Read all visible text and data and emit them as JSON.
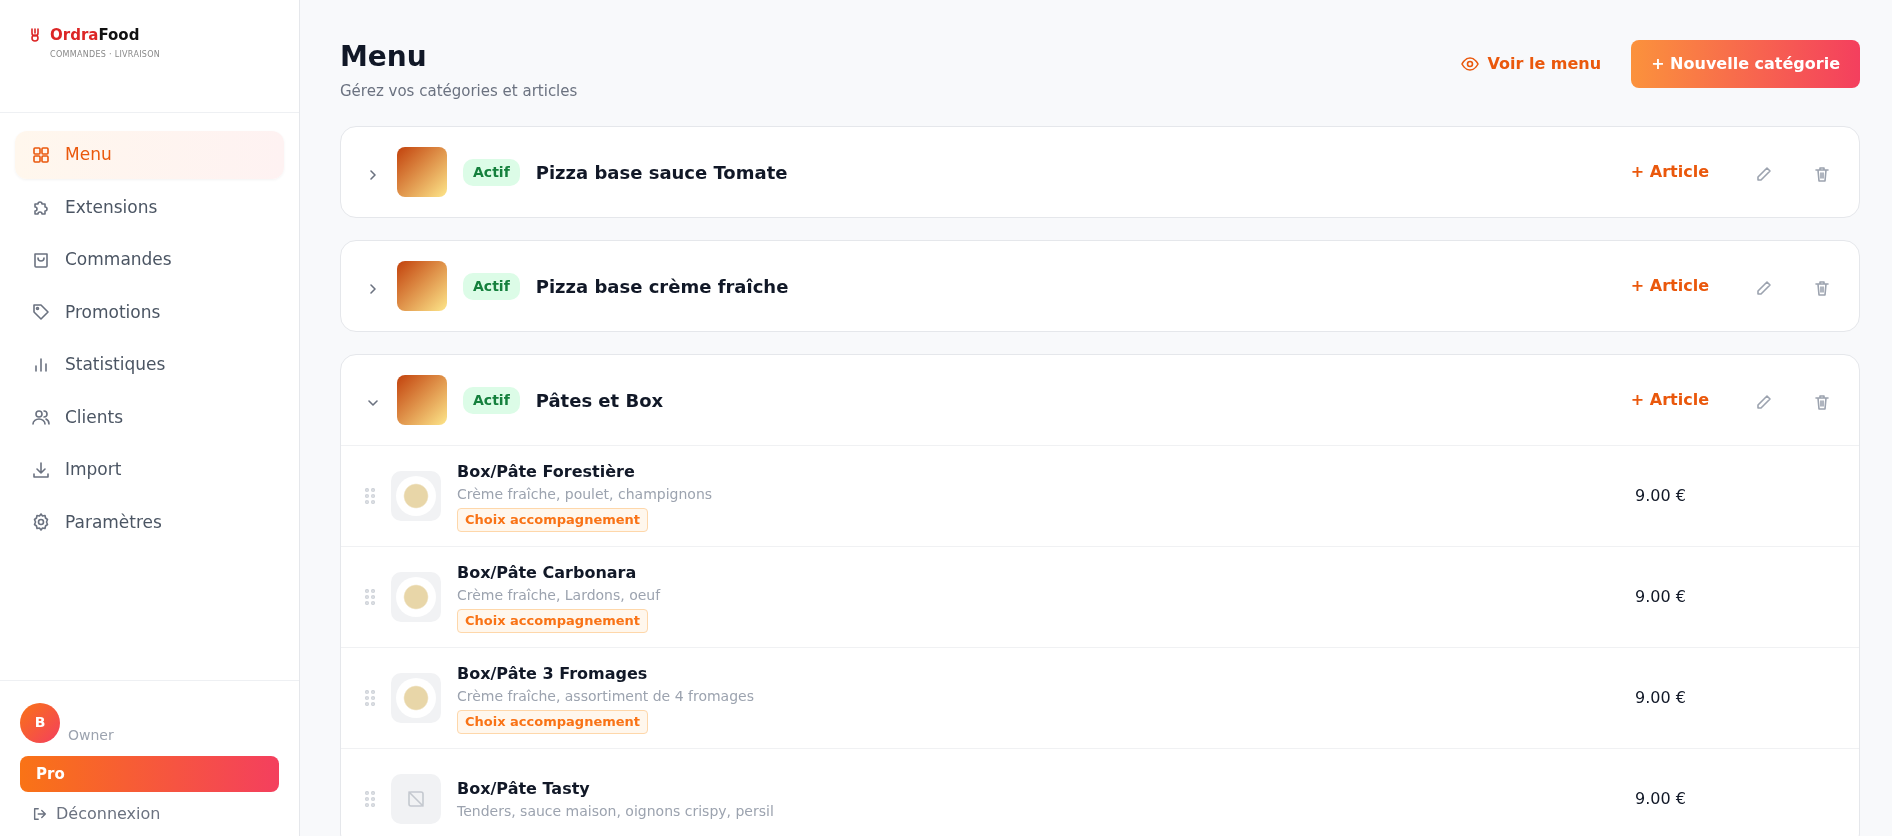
{
  "brand": {
    "name_part_1": "Ordra",
    "name_part_2": "Food",
    "tagline": "COMMANDES · LIVRAISON"
  },
  "sidebar": {
    "items": [
      {
        "label": "Menu",
        "selected": true
      },
      {
        "label": "Extensions",
        "selected": false
      },
      {
        "label": "Commandes",
        "selected": false
      },
      {
        "label": "Promotions",
        "selected": false
      },
      {
        "label": "Statistiques",
        "selected": false
      },
      {
        "label": "Clients",
        "selected": false
      },
      {
        "label": "Import",
        "selected": false
      },
      {
        "label": "Paramètres",
        "selected": false
      }
    ]
  },
  "user": {
    "initial": "B",
    "role": "Owner",
    "plan": "Pro",
    "logout": "Déconnexion"
  },
  "header": {
    "title": "Menu",
    "subtitle": "Gérez vos catégories et articles",
    "view_button": "Voir le menu",
    "new_button": "+ Nouvelle catégorie"
  },
  "categories": [
    {
      "name": "Pizza base sauce Tomate",
      "status": "Actif",
      "add_label": "+ Article",
      "expanded": false
    },
    {
      "name": "Pizza base crème fraîche",
      "status": "Actif",
      "add_label": "+ Article",
      "expanded": false
    },
    {
      "name": "Pâtes et Box",
      "status": "Actif",
      "add_label": "+ Article",
      "expanded": true,
      "items": [
        {
          "kind": "photo",
          "name": "Box/Pâte Forestière",
          "description": "Crème fraîche, poulet, champignons",
          "tag": "Choix accompagnement",
          "price": "9.00 €"
        },
        {
          "kind": "photo",
          "name": "Box/Pâte Carbonara",
          "description": "Crème fraîche, Lardons, oeuf",
          "tag": "Choix accompagnement",
          "price": "9.00 €"
        },
        {
          "kind": "photo",
          "name": "Box/Pâte 3 Fromages",
          "description": "Crème fraîche, assortiment de 4 fromages",
          "tag": "Choix accompagnement",
          "price": "9.00 €"
        },
        {
          "kind": "no_image",
          "name": "Box/Pâte Tasty",
          "description": "Tenders, sauce maison, oignons crispy, persil",
          "price": "9.00 €"
        }
      ]
    }
  ]
}
